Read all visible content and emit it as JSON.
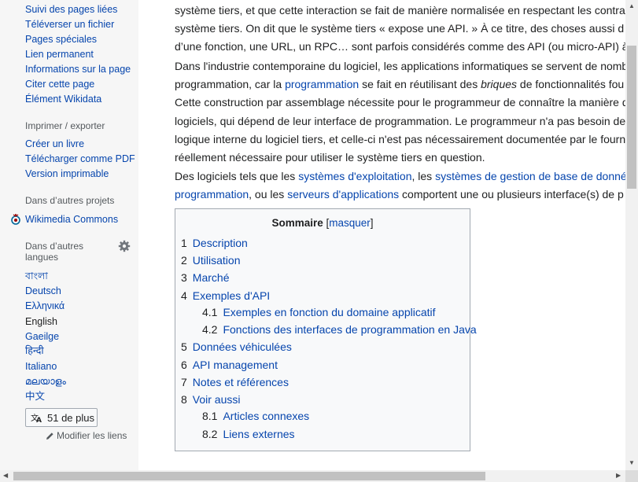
{
  "sidebar": {
    "tools": [
      "Suivi des pages liées",
      "Téléverser un fichier",
      "Pages spéciales",
      "Lien permanent",
      "Informations sur la page",
      "Citer cette page",
      "Élément Wikidata"
    ],
    "print_heading": "Imprimer / exporter",
    "print": [
      "Créer un livre",
      "Télécharger comme PDF",
      "Version imprimable"
    ],
    "projects_heading": "Dans d’autres projets",
    "commons": "Wikimedia Commons",
    "languages_heading_1": "Dans d’autres",
    "languages_heading_2": "langues",
    "languages": [
      "বাংলা",
      "Deutsch",
      "Ελληνικά",
      "English",
      "Gaeilge",
      "हिन्दी",
      "Italiano",
      "മലയാളം",
      "中文"
    ],
    "more_languages": "51 de plus",
    "edit_links": "Modifier les liens"
  },
  "content": {
    "p1_line1": "système tiers, et que cette interaction se fait de manière normalisée en respectant les contra",
    "p1_line2": "système tiers. On dit que le système tiers « expose une API. » À ce titre, des choses aussi d",
    "p1_line3": "d’une fonction, une URL, un RPC… sont parfois considérés comme des API (ou micro-API) à",
    "p2_line1": "Dans l'industrie contemporaine du logiciel, les applications informatiques se servent de nomb",
    "p2_line2_a": "programmation, car la ",
    "p2_line2_link": "programmation",
    "p2_line2_b": " se fait en réutilisant des ",
    "p2_line2_em": "briques",
    "p2_line2_c": " de fonctionnalités fou",
    "p2_line3": "Cette construction par assemblage nécessite pour le programmeur de connaître la manière d",
    "p2_line4": "logiciels, qui dépend de leur interface de programmation. Le programmeur n'a pas besoin de",
    "p2_line5": "logique interne du logiciel tiers, et celle-ci n'est pas nécessairement documentée par le fourn",
    "p2_line6": "réellement nécessaire pour utiliser le système tiers en question.",
    "p3_line1_a": "Des logiciels tels que les ",
    "p3_line1_link1": "systèmes d'exploitation",
    "p3_line1_b": ", les ",
    "p3_line1_link2": "systèmes de gestion de base de donné",
    "p3_line2_link1": "programmation",
    "p3_line2_a": ", ou les ",
    "p3_line2_link2": "serveurs d'applications",
    "p3_line2_b": " comportent une ou plusieurs interface(s) de p"
  },
  "toc": {
    "title": "Sommaire",
    "bracket_open": "[",
    "toggle": "masquer",
    "bracket_close": "]",
    "items": [
      {
        "num": "1",
        "label": "Description"
      },
      {
        "num": "2",
        "label": "Utilisation"
      },
      {
        "num": "3",
        "label": "Marché"
      },
      {
        "num": "4",
        "label": "Exemples d'API"
      },
      {
        "num": "4.1",
        "label": "Exemples en fonction du domaine applicatif"
      },
      {
        "num": "4.2",
        "label": "Fonctions des interfaces de programmation en Java"
      },
      {
        "num": "5",
        "label": "Données véhiculées"
      },
      {
        "num": "6",
        "label": "API management"
      },
      {
        "num": "7",
        "label": "Notes et références"
      },
      {
        "num": "8",
        "label": "Voir aussi"
      },
      {
        "num": "8.1",
        "label": "Articles connexes"
      },
      {
        "num": "8.2",
        "label": "Liens externes"
      }
    ]
  },
  "icons": {
    "commons": "wikimedia-commons-icon",
    "gear": "gear-icon",
    "translate": "translate-icon",
    "pencil": "pencil-icon"
  },
  "colors": {
    "link": "#0645ad",
    "text": "#202122",
    "sidebar_bg": "#f6f6f6",
    "toc_bg": "#f8f9fa"
  }
}
